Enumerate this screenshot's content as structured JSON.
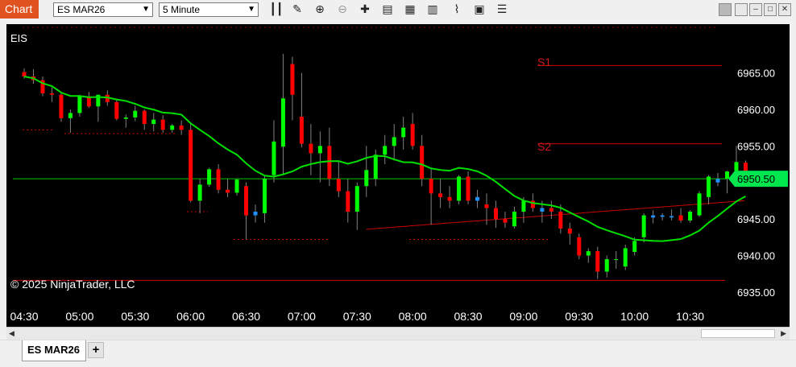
{
  "app": {
    "tag": "Chart"
  },
  "toolbar": {
    "instrument": "ES MAR26",
    "interval": "5 Minute",
    "icons": [
      "bar-type-icon",
      "draw-pencil-icon",
      "zoom-in-icon",
      "zoom-out-icon",
      "crosshair-icon",
      "data-box-icon",
      "indicators-icon",
      "strategies-icon",
      "drawing-tools-icon",
      "chart-trader-icon",
      "properties-icon"
    ]
  },
  "chart": {
    "symbol_label": "EIS",
    "copyright": "© 2025 NinjaTrader, LLC",
    "current_price": "6950.50",
    "colors": {
      "up": "#00ff00",
      "down": "#ff0000",
      "flat_up": "#1e90ff",
      "sma": "#00e000",
      "level": "#cc0000",
      "price_line": "#00c800"
    },
    "pivot_labels": {
      "s1": "S1",
      "s2": "S2"
    }
  },
  "chart_data": {
    "type": "candlestick",
    "ylim": [
      6934.0,
      6971.0
    ],
    "ytick_labels": [
      "6965.00",
      "6960.00",
      "6955.00",
      "6950.00",
      "6945.00",
      "6940.00",
      "6935.00"
    ],
    "yticks": [
      6965,
      6960,
      6955,
      6950,
      6945,
      6940,
      6935
    ],
    "xtick_labels": [
      "04:30",
      "05:00",
      "05:30",
      "06:00",
      "06:30",
      "07:00",
      "07:30",
      "08:00",
      "08:30",
      "09:00",
      "09:30",
      "10:00",
      "10:30"
    ],
    "x_start": "04:30",
    "bar_minutes": 5,
    "levels": {
      "s1": 6966.0,
      "s2": 6955.3,
      "low_line": 6936.6,
      "current": 6950.5
    },
    "trendline": {
      "from": [
        "07:35",
        6943.6
      ],
      "to": [
        "10:55",
        6947.5
      ]
    },
    "candles": [
      [
        "04:30",
        6965.1,
        6965.6,
        6964.2,
        6964.5
      ],
      [
        "04:35",
        6964.5,
        6965.5,
        6963.5,
        6964.0
      ],
      [
        "04:40",
        6964.0,
        6964.5,
        6961.8,
        6962.2
      ],
      [
        "04:45",
        6962.2,
        6963.0,
        6961.0,
        6962.0
      ],
      [
        "04:50",
        6962.0,
        6962.2,
        6958.3,
        6958.8
      ],
      [
        "04:55",
        6958.8,
        6960.0,
        6956.8,
        6959.5
      ],
      [
        "05:00",
        6959.5,
        6962.0,
        6959.0,
        6961.8
      ],
      [
        "05:05",
        6961.8,
        6962.4,
        6960.2,
        6960.4
      ],
      [
        "05:10",
        6960.4,
        6962.0,
        6958.3,
        6962.0
      ],
      [
        "05:15",
        6962.0,
        6962.6,
        6960.5,
        6961.0
      ],
      [
        "05:20",
        6961.0,
        6961.4,
        6958.5,
        6958.7
      ],
      [
        "05:25",
        6958.7,
        6959.3,
        6957.5,
        6958.9
      ],
      [
        "05:30",
        6958.9,
        6960.5,
        6958.4,
        6959.8
      ],
      [
        "05:35",
        6959.8,
        6960.0,
        6957.2,
        6958.0
      ],
      [
        "05:40",
        6958.0,
        6959.5,
        6957.0,
        6958.6
      ],
      [
        "05:45",
        6958.6,
        6959.2,
        6956.8,
        6957.2
      ],
      [
        "05:50",
        6957.2,
        6958.0,
        6956.8,
        6957.8
      ],
      [
        "05:55",
        6957.8,
        6958.5,
        6956.5,
        6957.2
      ],
      [
        "06:00",
        6957.2,
        6958.0,
        6947.3,
        6947.5
      ],
      [
        "06:05",
        6947.5,
        6950.5,
        6945.8,
        6949.7
      ],
      [
        "06:10",
        6949.7,
        6952.0,
        6949.4,
        6951.8
      ],
      [
        "06:15",
        6951.8,
        6952.5,
        6948.5,
        6949.0
      ],
      [
        "06:20",
        6949.0,
        6950.5,
        6948.0,
        6948.6
      ],
      [
        "06:25",
        6948.6,
        6950.5,
        6948.2,
        6950.4
      ],
      [
        "06:30",
        6949.5,
        6950.0,
        6942.2,
        6945.5
      ],
      [
        "06:35",
        6945.5,
        6947.0,
        6944.5,
        6946.0
      ],
      [
        "06:40",
        6945.8,
        6951.0,
        6944.5,
        6950.5
      ],
      [
        "06:45",
        6951.0,
        6958.5,
        6950.0,
        6955.6
      ],
      [
        "06:50",
        6954.9,
        6967.6,
        6951.0,
        6961.5
      ],
      [
        "06:55",
        6966.2,
        6967.2,
        6958.5,
        6962.0
      ],
      [
        "07:00",
        6959.0,
        6965.0,
        6954.8,
        6955.3
      ],
      [
        "07:05",
        6955.3,
        6958.0,
        6951.0,
        6954.0
      ],
      [
        "07:10",
        6954.0,
        6957.0,
        6950.0,
        6955.0
      ],
      [
        "07:15",
        6955.0,
        6957.5,
        6949.5,
        6950.5
      ],
      [
        "07:20",
        6950.5,
        6953.0,
        6948.0,
        6948.8
      ],
      [
        "07:25",
        6948.8,
        6950.5,
        6944.5,
        6946.0
      ],
      [
        "07:30",
        6946.0,
        6950.0,
        6943.5,
        6949.5
      ],
      [
        "07:35",
        6949.5,
        6955.0,
        6948.0,
        6951.7
      ],
      [
        "07:40",
        6950.5,
        6954.5,
        6949.5,
        6953.8
      ],
      [
        "07:45",
        6953.8,
        6956.5,
        6952.5,
        6955.0
      ],
      [
        "07:50",
        6955.0,
        6958.0,
        6953.0,
        6956.2
      ],
      [
        "07:55",
        6956.2,
        6959.0,
        6954.5,
        6957.5
      ],
      [
        "08:00",
        6958.0,
        6959.5,
        6954.5,
        6955.0
      ],
      [
        "08:05",
        6955.0,
        6956.5,
        6949.5,
        6950.5
      ],
      [
        "08:10",
        6950.5,
        6951.8,
        6944.2,
        6948.5
      ],
      [
        "08:15",
        6948.5,
        6950.5,
        6946.5,
        6948.0
      ],
      [
        "08:20",
        6948.0,
        6949.5,
        6946.5,
        6947.5
      ],
      [
        "08:25",
        6947.5,
        6951.0,
        6947.0,
        6950.8
      ],
      [
        "08:30",
        6950.8,
        6951.5,
        6947.0,
        6947.5
      ],
      [
        "08:35",
        6947.5,
        6949.0,
        6946.5,
        6948.0
      ],
      [
        "08:40",
        6947.0,
        6948.5,
        6944.2,
        6946.5
      ],
      [
        "08:45",
        6946.5,
        6947.5,
        6943.8,
        6945.0
      ],
      [
        "08:50",
        6945.0,
        6946.0,
        6943.8,
        6944.5
      ],
      [
        "08:55",
        6944.0,
        6946.7,
        6943.7,
        6946.0
      ],
      [
        "09:00",
        6946.0,
        6948.0,
        6944.5,
        6947.5
      ],
      [
        "09:05",
        6947.5,
        6948.5,
        6946.0,
        6946.5
      ],
      [
        "09:10",
        6946.0,
        6947.5,
        6944.5,
        6946.5
      ],
      [
        "09:15",
        6946.5,
        6947.5,
        6945.0,
        6946.0
      ],
      [
        "09:20",
        6946.0,
        6947.0,
        6943.0,
        6943.7
      ],
      [
        "09:25",
        6943.7,
        6944.5,
        6941.5,
        6943.0
      ],
      [
        "09:30",
        6942.5,
        6943.0,
        6939.5,
        6940.0
      ],
      [
        "09:35",
        6940.0,
        6941.0,
        6939.0,
        6940.6
      ],
      [
        "09:40",
        6940.6,
        6941.2,
        6936.8,
        6937.8
      ],
      [
        "09:45",
        6937.8,
        6940.0,
        6937.0,
        6939.5
      ],
      [
        "09:50",
        6939.5,
        6940.6,
        6938.2,
        6939.5
      ],
      [
        "09:55",
        6938.5,
        6941.5,
        6938.0,
        6941.0
      ],
      [
        "10:00",
        6940.5,
        6942.5,
        6940.0,
        6942.0
      ],
      [
        "10:05",
        6942.5,
        6945.8,
        6941.8,
        6945.5
      ],
      [
        "10:10",
        6945.2,
        6946.2,
        6944.4,
        6945.5
      ],
      [
        "10:15",
        6945.3,
        6945.8,
        6944.8,
        6945.5
      ],
      [
        "10:20",
        6945.2,
        6946.3,
        6944.8,
        6945.4
      ],
      [
        "10:25",
        6945.5,
        6946.5,
        6944.5,
        6944.8
      ],
      [
        "10:30",
        6944.8,
        6946.2,
        6944.5,
        6946.0
      ],
      [
        "10:35",
        6945.5,
        6948.8,
        6945.3,
        6948.5
      ],
      [
        "10:40",
        6948.0,
        6951.0,
        6947.0,
        6950.8
      ],
      [
        "10:45",
        6950.0,
        6951.3,
        6949.5,
        6950.5
      ],
      [
        "10:50",
        6950.5,
        6951.6,
        6948.5,
        6951.5
      ],
      [
        "10:55",
        6951.6,
        6955.0,
        6951.0,
        6952.8
      ],
      [
        "11:00",
        6952.7,
        6953.0,
        6950.0,
        6950.5
      ]
    ]
  }
}
